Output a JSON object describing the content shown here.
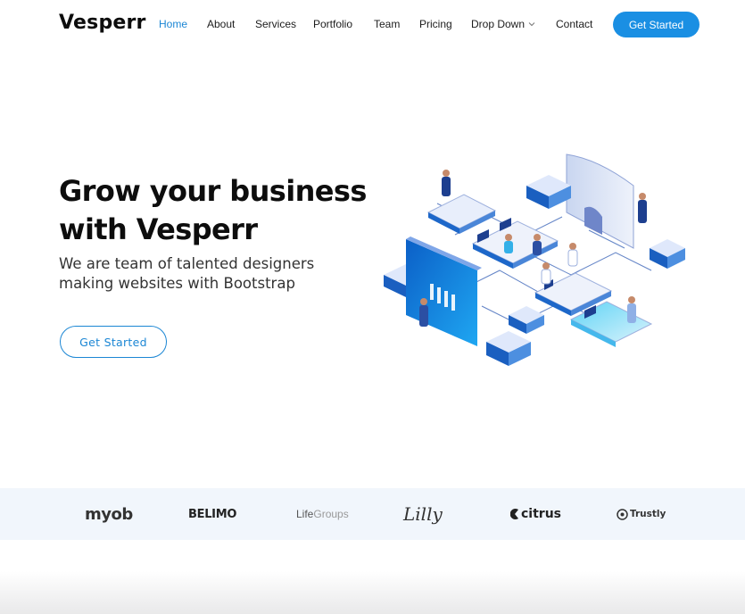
{
  "header": {
    "logo": "Vesperr",
    "nav": [
      {
        "label": "Home",
        "active": true
      },
      {
        "label": "About"
      },
      {
        "label": "Services"
      },
      {
        "label": "Portfolio"
      },
      {
        "label": "Team"
      },
      {
        "label": "Pricing"
      },
      {
        "label": "Drop Down",
        "dropdown": true
      },
      {
        "label": "Contact"
      }
    ],
    "cta_label": "Get Started"
  },
  "hero": {
    "title_line1": "Grow your business",
    "title_line2": "with Vesperr",
    "subtitle_line1": "We are team of talented designers",
    "subtitle_line2": "making websites with Bootstrap",
    "button_label": "Get Started",
    "illustration": "isometric-tech-team-illustration"
  },
  "clients": [
    {
      "name": "myob"
    },
    {
      "name": "BELIMO"
    },
    {
      "name": "LifeGroups",
      "part1": "Life",
      "part2": "Groups"
    },
    {
      "name": "Lilly"
    },
    {
      "name": "citrus"
    },
    {
      "name": "Trustly"
    }
  ],
  "colors": {
    "accent": "#1b86d4",
    "button_fill": "#1a8fe3",
    "clients_band": "#f1f6fc",
    "text_dark": "#0d0d0d"
  }
}
